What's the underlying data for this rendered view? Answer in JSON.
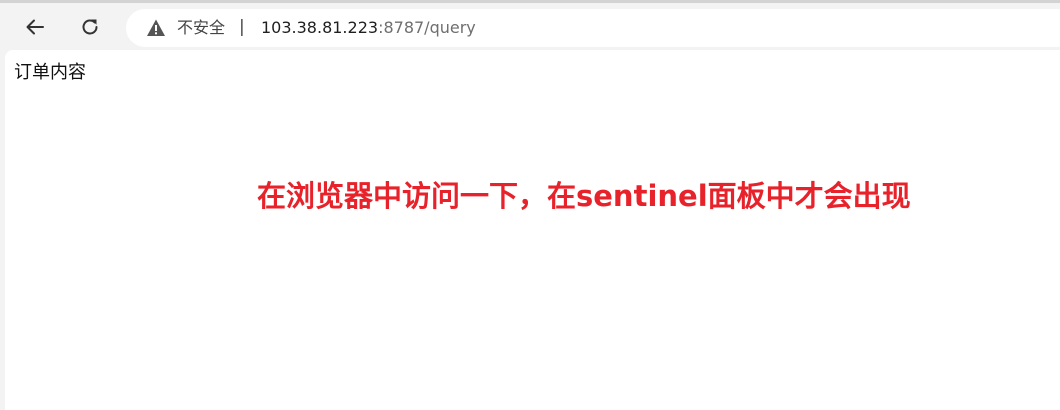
{
  "browser": {
    "security_label": "不安全",
    "separator": "|",
    "url_host": "103.38.81.223",
    "url_rest": ":8787/query",
    "icons": {
      "back": "arrow-left-icon",
      "reload": "reload-icon",
      "security": "warning-triangle-icon"
    }
  },
  "page": {
    "body_text": "订单内容"
  },
  "annotation": {
    "text": "在浏览器中访问一下，在sentinel面板中才会出现",
    "color": "#e8222a"
  }
}
